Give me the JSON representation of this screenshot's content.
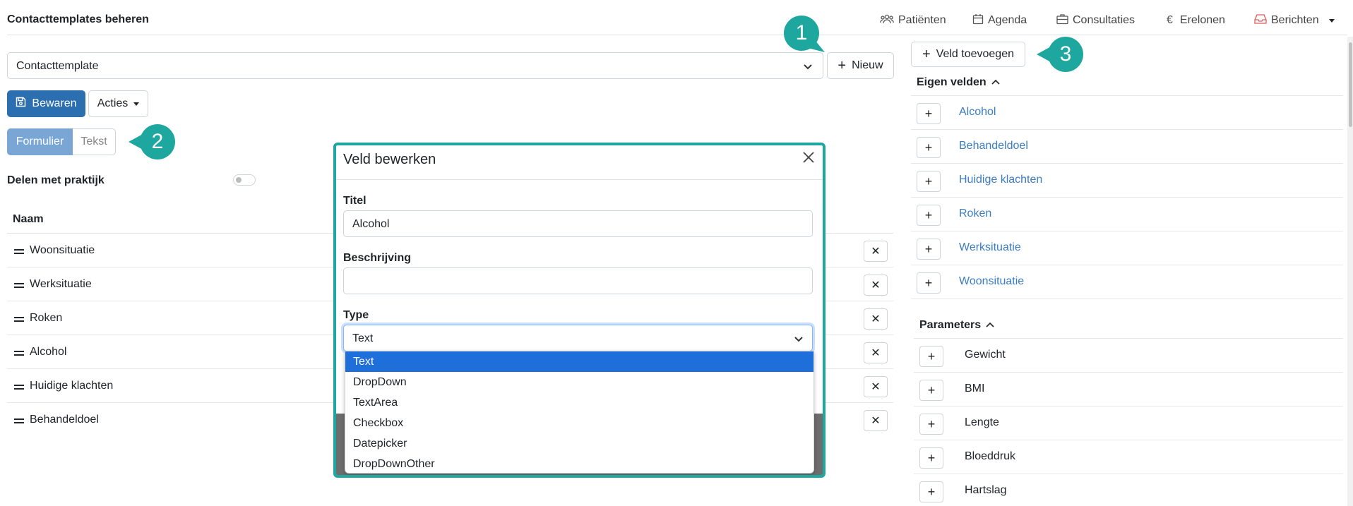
{
  "header": {
    "title": "Contacttemplates beheren",
    "nav": [
      {
        "label": "Patiënten",
        "icon": "users-icon"
      },
      {
        "label": "Agenda",
        "icon": "calendar-icon"
      },
      {
        "label": "Consultaties",
        "icon": "briefcase-icon"
      },
      {
        "label": "Erelonen",
        "icon": "euro-icon"
      },
      {
        "label": "Berichten",
        "icon": "inbox-icon"
      }
    ]
  },
  "template_select": {
    "value": "Contacttemplate"
  },
  "toolbar": {
    "new_label": "Nieuw",
    "save_label": "Bewaren",
    "actions_label": "Acties",
    "add_field_label": "Veld toevoegen"
  },
  "view_toggle": {
    "active": "Formulier",
    "inactive": "Tekst"
  },
  "share": {
    "label": "Delen met praktijk",
    "enabled": false
  },
  "table": {
    "header": "Naam",
    "rows": [
      "Woonsituatie",
      "Werksituatie",
      "Roken",
      "Alcohol",
      "Huidige klachten",
      "Behandeldoel"
    ]
  },
  "own_fields": {
    "title": "Eigen velden",
    "items": [
      "Alcohol",
      "Behandeldoel",
      "Huidige klachten",
      "Roken",
      "Werksituatie",
      "Woonsituatie"
    ]
  },
  "parameters": {
    "title": "Parameters",
    "items": [
      "Gewicht",
      "BMI",
      "Lengte",
      "Bloeddruk",
      "Hartslag"
    ]
  },
  "modal": {
    "title": "Veld bewerken",
    "title_label": "Titel",
    "title_value": "Alcohol",
    "description_label": "Beschrijving",
    "description_value": "",
    "type_label": "Type",
    "type_value": "Text",
    "type_options": [
      "Text",
      "DropDown",
      "TextArea",
      "Checkbox",
      "Datepicker",
      "DropDownOther"
    ]
  },
  "callouts": [
    "1",
    "2",
    "3"
  ],
  "colors": {
    "primary": "#2c6fb0",
    "accent": "#1ea79f",
    "link": "#3b7dc4",
    "selected_option": "#1e6fd9"
  }
}
